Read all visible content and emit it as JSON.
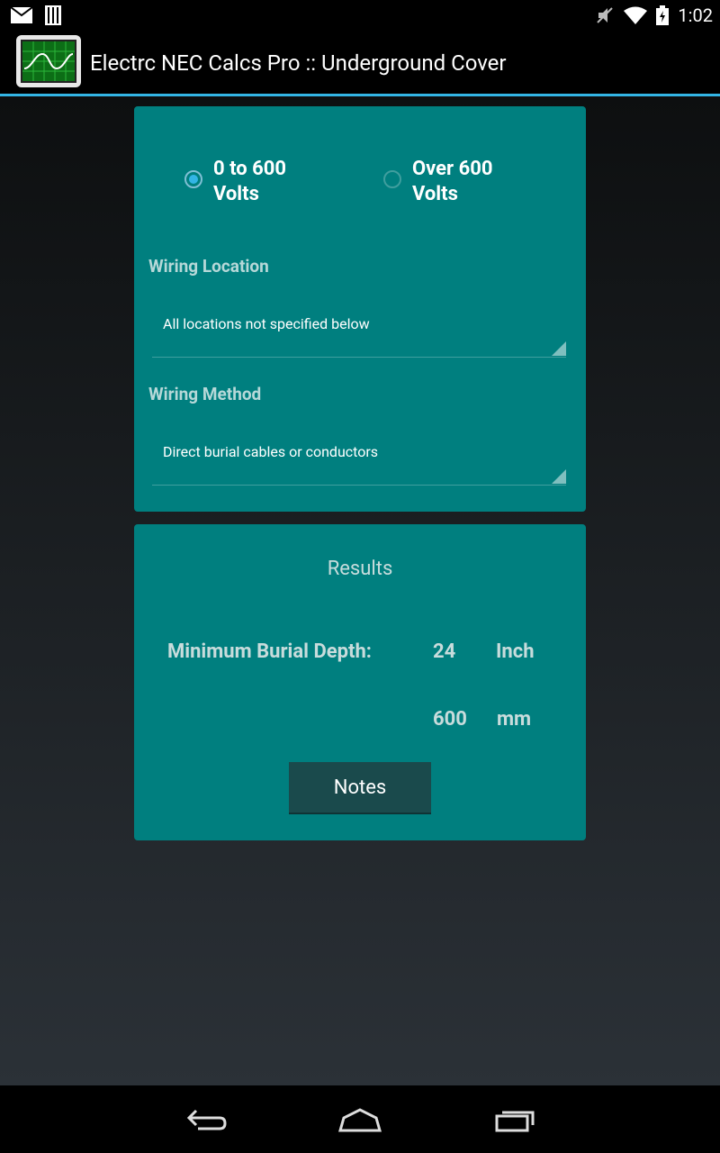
{
  "status_bar": {
    "time": "1:02",
    "icons_left": [
      "mail-icon",
      "sim-icon"
    ],
    "icons_right": [
      "mute-icon",
      "wifi-icon",
      "battery-icon"
    ]
  },
  "action_bar": {
    "title": "Electrc NEC Calcs Pro :: Underground Cover",
    "icon": "oscilloscope-app-icon"
  },
  "voltage": {
    "options": [
      {
        "label": "0 to 600 Volts",
        "checked": true
      },
      {
        "label": "Over 600 Volts",
        "checked": false
      }
    ]
  },
  "wiring_location": {
    "label": "Wiring Location",
    "value": "All locations not specified below"
  },
  "wiring_method": {
    "label": "Wiring Method",
    "value": "Direct burial cables or conductors"
  },
  "results": {
    "title": "Results",
    "min_depth_label": "Minimum Burial Depth:",
    "depth_value": "24",
    "depth_unit": "Inch",
    "depth_mm_value": "600",
    "depth_mm_unit": "mm",
    "notes_button": "Notes"
  },
  "colors": {
    "card": "#007f7f",
    "accent": "#33b5e5",
    "button": "#1a4a4c"
  },
  "nav_bar": {
    "buttons": [
      "back-icon",
      "home-icon",
      "recents-icon"
    ]
  }
}
